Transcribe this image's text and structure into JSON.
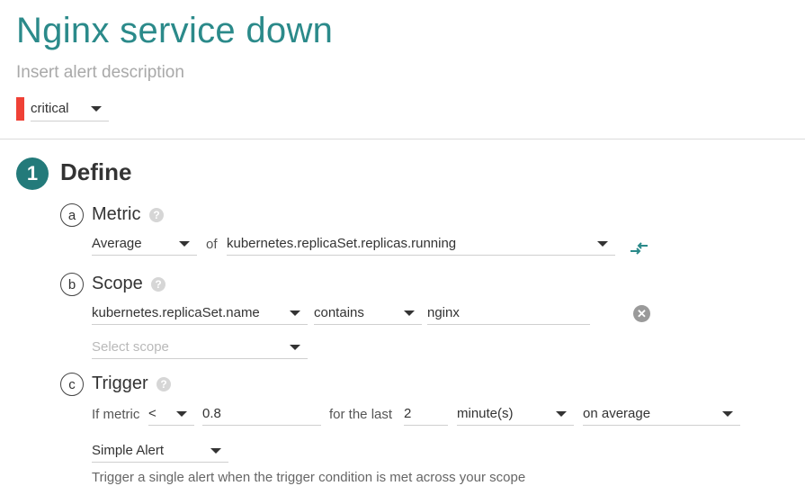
{
  "header": {
    "title": "Nginx service down",
    "description_placeholder": "Insert alert description",
    "severity": {
      "value": "critical",
      "color": "#ef4136"
    }
  },
  "define": {
    "step": "1",
    "title": "Define",
    "metric": {
      "letter": "a",
      "title": "Metric",
      "help": "?",
      "aggregation": "Average",
      "of_label": "of",
      "name": "kubernetes.replicaSet.replicas.running"
    },
    "scope": {
      "letter": "b",
      "title": "Scope",
      "help": "?",
      "key": "kubernetes.replicaSet.name",
      "operator": "contains",
      "value": "nginx",
      "clear": "✕",
      "add_placeholder": "Select scope"
    },
    "trigger": {
      "letter": "c",
      "title": "Trigger",
      "help": "?",
      "if_metric_label": "If metric",
      "comparator": "<",
      "threshold": "0.8",
      "for_the_last_label": "for the last",
      "duration": "2",
      "unit": "minute(s)",
      "aggregation": "on average",
      "alert_type": "Simple Alert",
      "alert_type_hint": "Trigger a single alert when the trigger condition is met across your scope"
    }
  },
  "colors": {
    "accent": "#2b8a8a",
    "step": "#237a7a",
    "critical": "#ef4136"
  },
  "icons": {
    "swap": "swap-arrows-icon",
    "clear": "clear-circle-icon",
    "help": "help-circle-icon"
  }
}
